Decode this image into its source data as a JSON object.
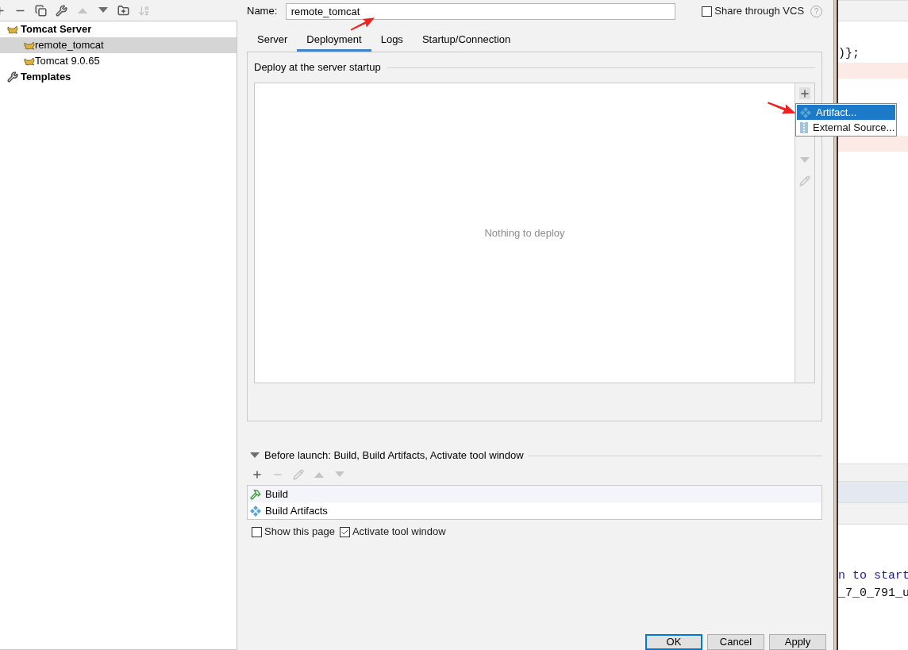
{
  "left_toolbar": [
    {
      "kind": "add",
      "disabled": false
    },
    {
      "kind": "remove",
      "disabled": false
    },
    {
      "kind": "copy",
      "disabled": false
    },
    {
      "kind": "wrench",
      "disabled": false
    },
    {
      "kind": "up",
      "disabled": true
    },
    {
      "kind": "down",
      "disabled": false
    },
    {
      "kind": "folder",
      "disabled": false
    },
    {
      "kind": "sort",
      "disabled": true
    }
  ],
  "tree": [
    {
      "label": "Tomcat Server",
      "kind": "server",
      "selected": false,
      "children": [
        {
          "label": "remote_tomcat",
          "kind": "server",
          "selected": true
        },
        {
          "label": "Tomcat 9.0.65",
          "kind": "server",
          "selected": false
        }
      ]
    },
    {
      "label": "Templates",
      "kind": "templates",
      "selected": false
    }
  ],
  "name_field": {
    "label": "Name:",
    "value": "remote_tomcat"
  },
  "share_vcs": {
    "label": "Share through VCS",
    "checked": false
  },
  "help_button": "?",
  "tabs": [
    {
      "label": "Server",
      "selected": false
    },
    {
      "label": "Deployment",
      "selected": true
    },
    {
      "label": "Logs",
      "selected": false
    },
    {
      "label": "Startup/Connection",
      "selected": false
    }
  ],
  "deploy": {
    "title": "Deploy at the server startup",
    "empty_text": "Nothing to deploy",
    "side_tools": [
      {
        "kind": "add",
        "disabled": false
      },
      {
        "kind": "down",
        "disabled": true
      },
      {
        "kind": "edit",
        "disabled": true
      }
    ]
  },
  "popup_menu": [
    {
      "label": "Artifact...",
      "kind": "artifact",
      "selected": true
    },
    {
      "label": "External Source...",
      "kind": "external",
      "selected": false
    }
  ],
  "before_launch": {
    "title": "Before launch: Build, Build Artifacts, Activate tool window",
    "expanded": true,
    "tools": [
      {
        "kind": "add",
        "disabled": false
      },
      {
        "kind": "remove",
        "disabled": true
      },
      {
        "kind": "edit",
        "disabled": true
      },
      {
        "kind": "up",
        "disabled": true
      },
      {
        "kind": "down",
        "disabled": true
      }
    ],
    "tasks": [
      {
        "label": "Build",
        "kind": "build",
        "selected": true
      },
      {
        "label": "Build Artifacts",
        "kind": "artifact",
        "selected": false
      }
    ]
  },
  "show_this_page": {
    "label": "Show this page",
    "checked": false
  },
  "activate_tool_window": {
    "label": "Activate tool window",
    "checked": true
  },
  "buttons": [
    {
      "label": "OK",
      "default": true
    },
    {
      "label": "Cancel",
      "default": false
    },
    {
      "label": "Apply",
      "default": false
    }
  ],
  "editor": {
    "code_lines": [
      {
        "text": ")};",
        "kind": "code"
      },
      {
        "text": "n to start",
        "kind": "keyword"
      },
      {
        "text": "_7_0_791_u",
        "kind": "code"
      }
    ]
  }
}
